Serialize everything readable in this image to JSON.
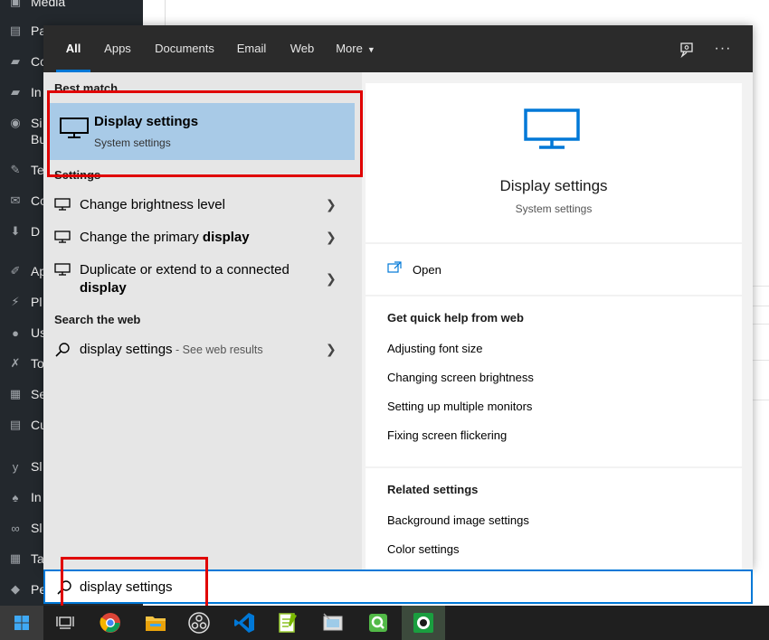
{
  "wp_sidebar": {
    "items": [
      {
        "label": "Media",
        "icon": "media-icon"
      },
      {
        "label": "Pa",
        "icon": "pages-icon"
      },
      {
        "label": "Co",
        "icon": "comments-icon"
      },
      {
        "label": "In",
        "icon": "inbox-icon"
      },
      {
        "label": "Si",
        "icon": "globe-icon"
      },
      {
        "label": "Bu",
        "icon": ""
      },
      {
        "label": "Te",
        "icon": "pin-icon"
      },
      {
        "label": "Co",
        "icon": "mail-icon"
      },
      {
        "label": "D",
        "icon": "download-icon"
      },
      {
        "label": "Ap",
        "icon": "brush-icon"
      },
      {
        "label": "Pl",
        "icon": "plugin-icon"
      },
      {
        "label": "Us",
        "icon": "user-icon"
      },
      {
        "label": "To",
        "icon": "wrench-icon"
      },
      {
        "label": "Se",
        "icon": "settings-icon"
      },
      {
        "label": "Cu",
        "icon": "table-icon"
      },
      {
        "label": "Sl",
        "icon": "yoast-icon"
      },
      {
        "label": "In",
        "icon": "hat-icon"
      },
      {
        "label": "Sl",
        "icon": "link-icon"
      },
      {
        "label": "Ta",
        "icon": "grid-icon"
      },
      {
        "label": "Pe",
        "icon": "box-icon"
      }
    ]
  },
  "search": {
    "tabs": [
      {
        "label": "All",
        "active": true
      },
      {
        "label": "Apps"
      },
      {
        "label": "Documents"
      },
      {
        "label": "Email"
      },
      {
        "label": "Web"
      },
      {
        "label": "More"
      }
    ],
    "toolbar_icons": [
      "feedback-icon",
      "more-options-icon"
    ],
    "sections": {
      "best_match": "Best match",
      "settings": "Settings",
      "search_web": "Search the web"
    },
    "best_match": {
      "title": "Display settings",
      "subtitle": "System settings"
    },
    "settings_results": [
      {
        "pre": "Change brightness level",
        "bold": "",
        "line2": ""
      },
      {
        "pre": "Change the primary ",
        "bold": "display",
        "line2": ""
      },
      {
        "pre": "Duplicate or extend to a connected",
        "bold": "",
        "line2": "display"
      }
    ],
    "web_result": {
      "query": "display settings",
      "suffix": " - See web results"
    },
    "preview": {
      "title": "Display settings",
      "subtitle": "System settings",
      "open_label": "Open",
      "help_header": "Get quick help from web",
      "help_links": [
        "Adjusting font size",
        "Changing screen brightness",
        "Setting up multiple monitors",
        "Fixing screen flickering"
      ],
      "related_header": "Related settings",
      "related_links": [
        "Background image settings",
        "Color settings"
      ]
    },
    "input_value": "display settings",
    "accent_color": "#0078d7",
    "highlight_color": "#e00000"
  },
  "taskbar": {
    "apps": [
      "windows-start-icon",
      "task-view-icon",
      "chrome-icon",
      "file-explorer-icon",
      "obs-icon",
      "vscode-icon",
      "notepad-plus-plus-icon",
      "screenshot-tool-icon",
      "qlik-icon",
      "active-app-icon"
    ]
  }
}
